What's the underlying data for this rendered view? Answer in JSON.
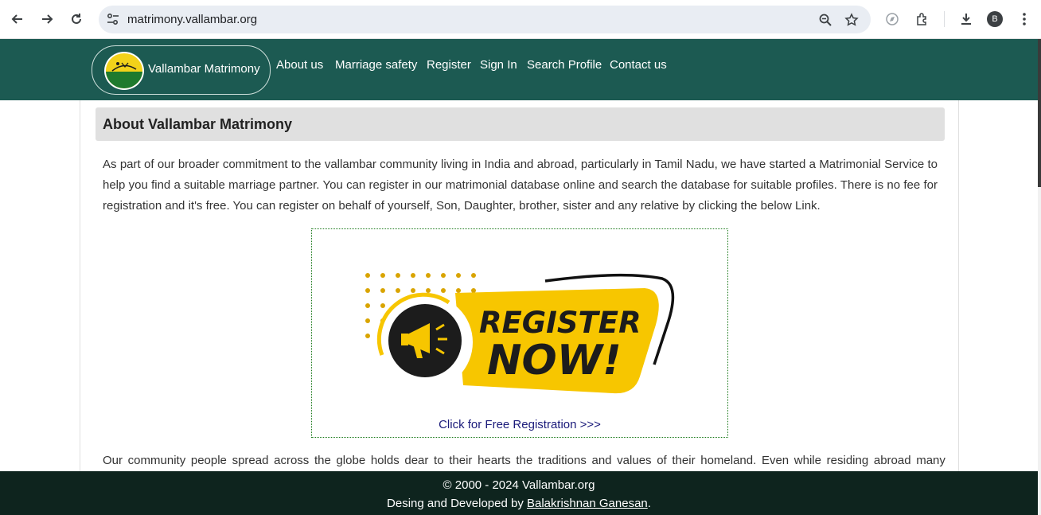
{
  "browser": {
    "url": "matrimony.vallambar.org",
    "avatar_letter": "B",
    "icons": [
      "back-icon",
      "forward-icon",
      "reload-icon",
      "site-settings-icon",
      "zoom-icon",
      "bookmark-star-icon",
      "compass-icon",
      "extensions-icon",
      "download-icon",
      "kebab-menu-icon"
    ]
  },
  "header": {
    "brand": "Vallambar Matrimony",
    "nav": [
      "About us",
      "Marriage safety",
      "Register",
      "Sign In",
      "Search Profile",
      "Contact us"
    ]
  },
  "main": {
    "title": "About Vallambar Matrimony",
    "intro": "As part of our broader commitment to the vallambar community living in India and abroad, particularly in Tamil Nadu, we have started a Matrimonial Service to help you find a suitable marriage partner. You can register in our matrimonial database online and search the database for suitable profiles. There is no fee for registration and it's free. You can register on behalf of yourself, Son, Daughter, brother, sister and any relative by clicking the below Link.",
    "banner": {
      "line1": "REGISTER",
      "line2": "NOW!"
    },
    "register_link": "Click for Free Registration >>>",
    "para2": "Our community people spread across the globe holds dear to their hearts the traditions and values of their homeland. Even while residing abroad many"
  },
  "footer": {
    "copyright": "© 2000 - 2024 Vallambar.org",
    "credit_prefix": "Desing and Developed by ",
    "credit_name": "Balakrishnan Ganesan",
    "credit_suffix": "."
  },
  "colors": {
    "header_bg": "#1c5a52",
    "footer_bg": "#0e241e",
    "banner_yellow": "#f7c600",
    "link_blue": "#1a1a7a"
  }
}
